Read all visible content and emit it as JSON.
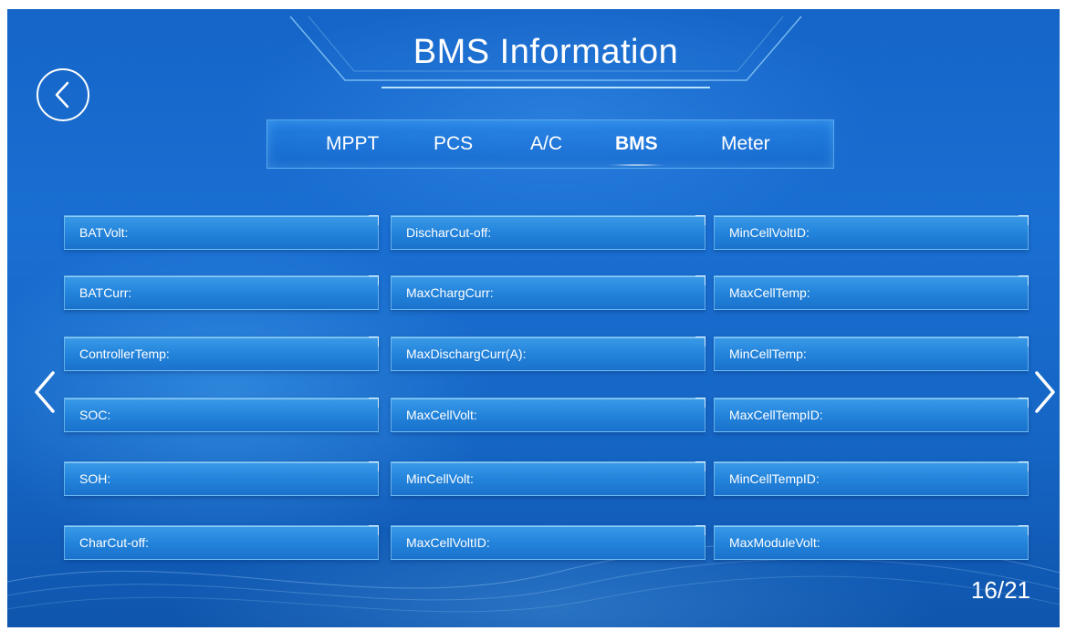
{
  "header": {
    "title": "BMS Information"
  },
  "tabs": [
    {
      "label": "MPPT",
      "active": false
    },
    {
      "label": "PCS",
      "active": false
    },
    {
      "label": "A/C",
      "active": false
    },
    {
      "label": "BMS",
      "active": true
    },
    {
      "label": "Meter",
      "active": false
    }
  ],
  "fields": {
    "col1": [
      "BATVolt:",
      "BATCurr:",
      "ControllerTemp:",
      "SOC:",
      "SOH:",
      "CharCut-off:"
    ],
    "col2": [
      "DischarCut-off:",
      "MaxChargCurr:",
      "MaxDischargCurr(A):",
      "MaxCellVolt:",
      "MinCellVolt:",
      "MaxCellVoltID:"
    ],
    "col3": [
      "MinCellVoltID:",
      "MaxCellTemp:",
      "MinCellTemp:",
      "MaxCellTempID:",
      "MinCellTempID:",
      "MaxModuleVolt:"
    ]
  },
  "pagination": {
    "text": "16/21",
    "current": 16,
    "total": 21
  },
  "icons": {
    "back": "back-circle-icon",
    "prev": "chevron-left-icon",
    "next": "chevron-right-icon"
  },
  "colors": {
    "background": "#1a6fd2",
    "field": "#2384db",
    "text": "#ffffff"
  }
}
